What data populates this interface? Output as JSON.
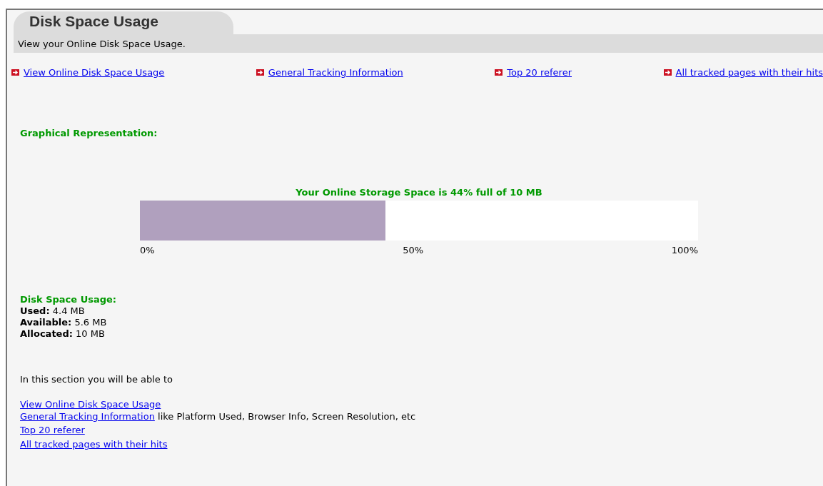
{
  "tab": {
    "title": "Disk Space Usage"
  },
  "subtitle": "View your Online Disk Space Usage.",
  "nav_links": [
    {
      "label": "View Online Disk Space Usage"
    },
    {
      "label": "General Tracking Information"
    },
    {
      "label": "Top 20 referer"
    },
    {
      "label": "All tracked pages with their hits"
    }
  ],
  "graph_heading": "Graphical Representation:",
  "usage_bar": {
    "caption": "Your Online Storage Space is 44% full of 10 MB",
    "level": 0.44,
    "ticks": [
      "0%",
      "50%",
      "100%"
    ]
  },
  "usage": {
    "heading": "Disk Space Usage:",
    "stats": [
      {
        "label": "Used:",
        "value": "4.4 MB"
      },
      {
        "label": "Available:",
        "value": "5.6 MB"
      },
      {
        "label": "Allocated:",
        "value": "10 MB"
      }
    ]
  },
  "intro": "In this section you will be able to",
  "section_links": [
    {
      "link": "View Online Disk Space Usage"
    },
    {
      "link": "General Tracking Information",
      "text": "like Platform Used, Browser Info, Screen Resolution, etc"
    },
    {
      "link": "Top 20 referer"
    },
    {
      "link": "All tracked pages with their hits"
    }
  ]
}
